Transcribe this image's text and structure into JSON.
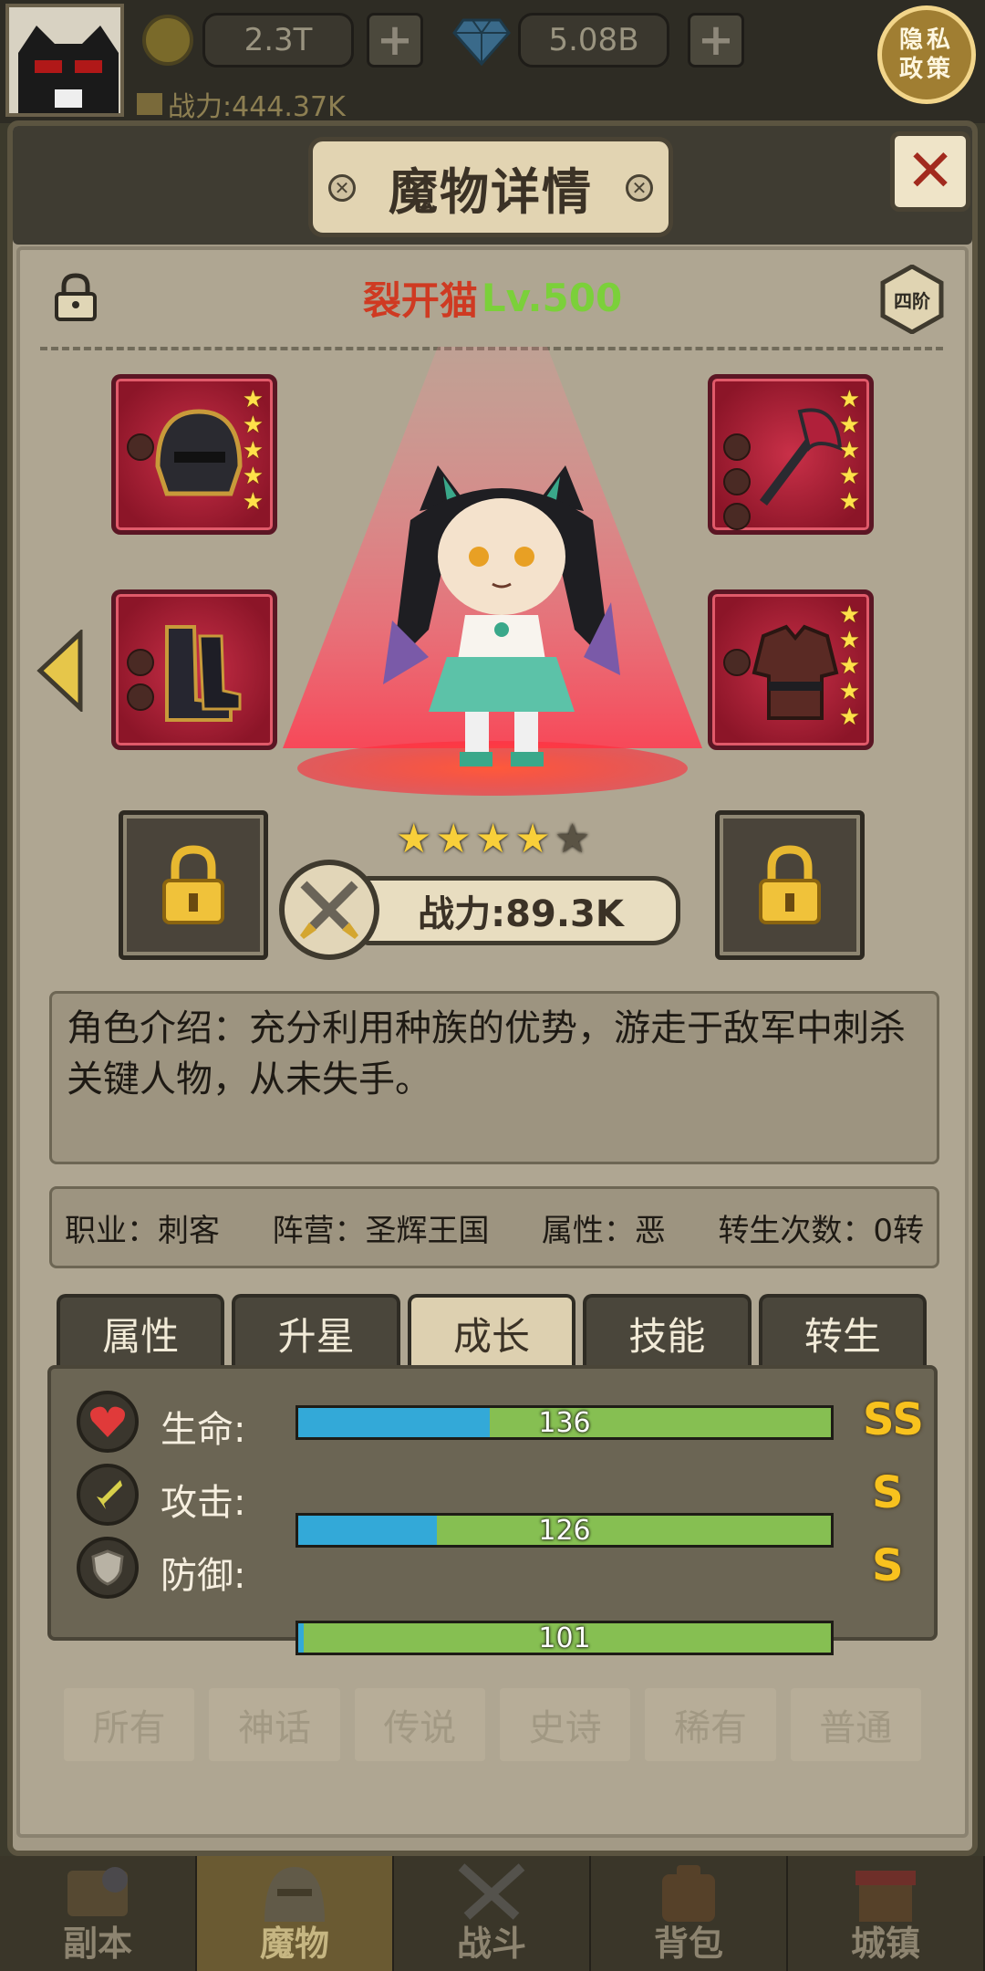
{
  "top_bar": {
    "gold_value": "2.3T",
    "gem_value": "5.08B",
    "plus_label": "+",
    "power_label": "战力:444.37K",
    "privacy_line1": "隐私",
    "privacy_line2": "政策"
  },
  "dialog": {
    "title": "魔物详情",
    "close_label": "✕"
  },
  "monster": {
    "name": "裂开猫",
    "level": "Lv.500",
    "tier": "四阶",
    "star_rating": 4,
    "star_max": 5,
    "combat_power": "战力:89.3K",
    "description": "角色介绍：充分利用种族的优势，游走于敌军中刺杀关键人物，从未失手。"
  },
  "equipment": [
    {
      "slot": "helmet",
      "stars": 5,
      "gems": 1
    },
    {
      "slot": "weapon",
      "stars": 5,
      "gems": 3
    },
    {
      "slot": "boots",
      "stars": 0,
      "gems": 2
    },
    {
      "slot": "armor",
      "stars": 5,
      "gems": 1
    }
  ],
  "info": {
    "class": "职业：刺客",
    "faction": "阵营：圣辉王国",
    "attribute": "属性：恶",
    "rebirth": "转生次数：0转"
  },
  "tabs": [
    {
      "label": "属性",
      "active": false
    },
    {
      "label": "升星",
      "active": false
    },
    {
      "label": "成长",
      "active": true
    },
    {
      "label": "技能",
      "active": false
    },
    {
      "label": "转生",
      "active": false
    }
  ],
  "growth_stats": [
    {
      "label": "生命:",
      "value": "136",
      "fill_percent": 36,
      "grade": "SS",
      "icon": "heart-icon"
    },
    {
      "label": "攻击:",
      "value": "126",
      "fill_percent": 26,
      "grade": "S",
      "icon": "sword-icon"
    },
    {
      "label": "防御:",
      "value": "101",
      "fill_percent": 1,
      "grade": "S",
      "icon": "shield-icon"
    }
  ],
  "filters": [
    "所有",
    "神话",
    "传说",
    "史诗",
    "稀有",
    "普通"
  ],
  "bottom_nav": [
    {
      "label": "副本",
      "active": false
    },
    {
      "label": "魔物",
      "active": true
    },
    {
      "label": "战斗",
      "active": false
    },
    {
      "label": "背包",
      "active": false
    },
    {
      "label": "城镇",
      "active": false
    }
  ],
  "colors": {
    "name": "#cf3a22",
    "level": "#7bd03a",
    "grade": "#f8c21e",
    "bar_fill": "#33a9d8",
    "bar_bg": "#86bf52"
  }
}
